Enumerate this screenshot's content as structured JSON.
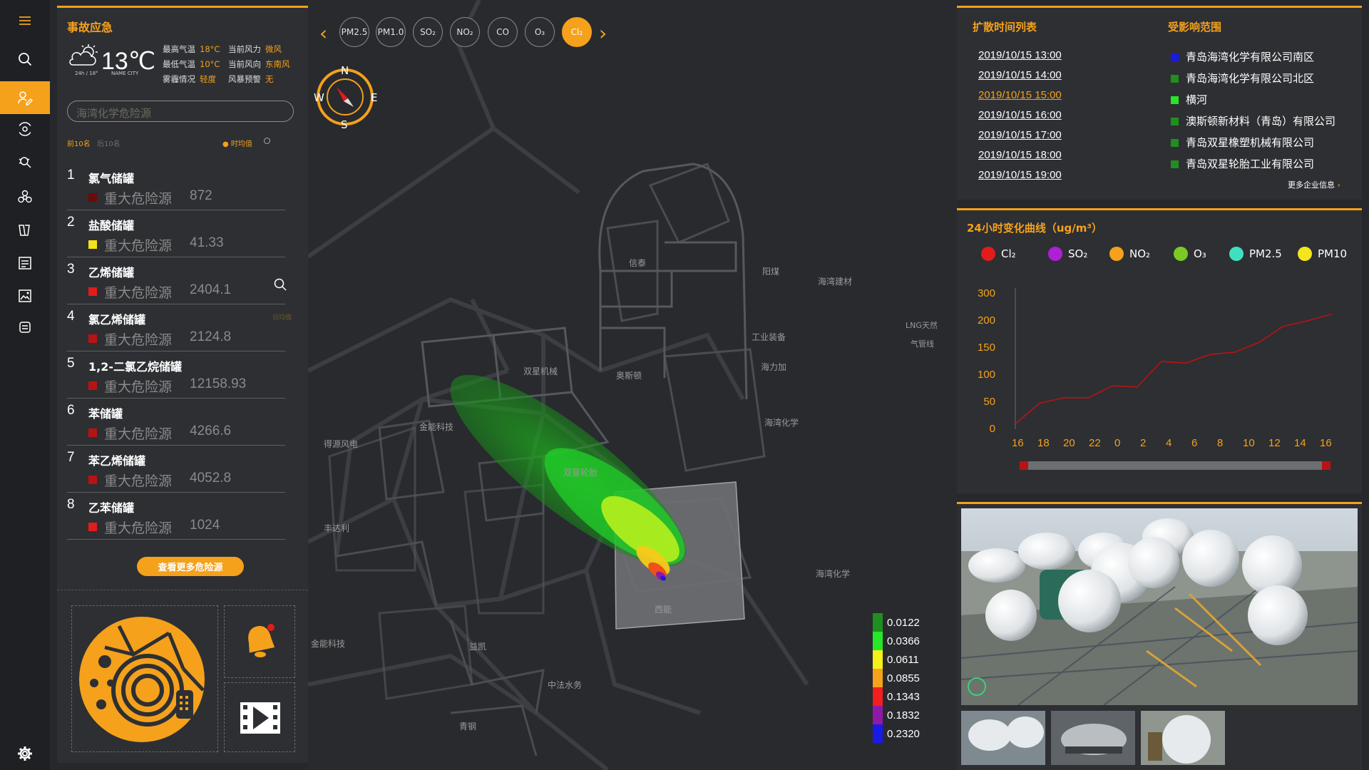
{
  "rail": {
    "items": [
      "menu-icon",
      "search-icon",
      "person-edit-icon",
      "radiation-icon",
      "bug-search-icon",
      "biohazard-icon",
      "book-icon",
      "report-icon",
      "image-report-icon",
      "list-icon",
      "settings-icon"
    ],
    "active_index": 2
  },
  "left_panel": {
    "title": "事故应急",
    "weather": {
      "temp": "13℃",
      "sub_left": "24h / 18°",
      "sub_city": "NAME CITY",
      "rows": [
        {
          "label": "最高气温",
          "value": "18°C",
          "label2": "当前风力",
          "value2": "微风"
        },
        {
          "label": "最低气温",
          "value": "10°C",
          "label2": "当前风向",
          "value2": "东南风"
        },
        {
          "label": "雾霾情况",
          "value": "轻度",
          "label2": "风暴预警",
          "value2": "无"
        }
      ]
    },
    "search_placeholder": "海湾化学危险源",
    "tabs": {
      "first": "前10名",
      "second": "后10名",
      "toggle_left": "时均值",
      "toggle_right": "日均值"
    },
    "category": "重大危险源",
    "items": [
      {
        "rank": "1",
        "name": "氯气储罐",
        "value": "872",
        "color": "#6b0b0b"
      },
      {
        "rank": "2",
        "name": "盐酸储罐",
        "value": "41.33",
        "color": "#f2e21a"
      },
      {
        "rank": "3",
        "name": "乙烯储罐",
        "value": "2404.1",
        "color": "#e21b1b"
      },
      {
        "rank": "4",
        "name": "氯乙烯储罐",
        "value": "2124.8",
        "color": "#b81313"
      },
      {
        "rank": "5",
        "name": "1,2-二氯乙烷储罐",
        "value": "12158.93",
        "color": "#b81313"
      },
      {
        "rank": "6",
        "name": "苯储罐",
        "value": "4266.6",
        "color": "#b81313"
      },
      {
        "rank": "7",
        "name": "苯乙烯储罐",
        "value": "4052.8",
        "color": "#b81313"
      },
      {
        "rank": "8",
        "name": "乙苯储罐",
        "value": "1024",
        "color": "#e21b1b"
      }
    ],
    "more_button": "查看更多危险源"
  },
  "map": {
    "pollutants": [
      "PM2.5",
      "PM1.0",
      "SO₂",
      "NO₂",
      "CO",
      "O₃",
      "Cl₂"
    ],
    "active_pollutant": "Cl₂",
    "compass": {
      "n": "N",
      "s": "S",
      "e": "E",
      "w": "W"
    },
    "labels": [
      "信泰",
      "阳煤",
      "海湾建材",
      "工业装备",
      "海力加",
      "LNG天然",
      "气管线",
      "双星机械",
      "奥斯顿",
      "金能科技",
      "海湾化学",
      "得源风电",
      "双星轮胎",
      "丰达利",
      "海湾化学",
      "西能",
      "金能科技",
      "益凯",
      "中法水务",
      "青钢"
    ],
    "scale": [
      {
        "value": "0.0122",
        "color": "#1f8f1f"
      },
      {
        "value": "0.0366",
        "color": "#27e627"
      },
      {
        "value": "0.0611",
        "color": "#f2f21a"
      },
      {
        "value": "0.0855",
        "color": "#f5a11b"
      },
      {
        "value": "0.1343",
        "color": "#f21f1f"
      },
      {
        "value": "0.1832",
        "color": "#8d1aa6"
      },
      {
        "value": "0.2320",
        "color": "#1a1ae6"
      }
    ]
  },
  "diffusion": {
    "title": "扩散时间列表",
    "times": [
      "2019/10/15 13:00",
      "2019/10/15 14:00",
      "2019/10/15 15:00",
      "2019/10/15 16:00",
      "2019/10/15 17:00",
      "2019/10/15 18:00",
      "2019/10/15 19:00"
    ],
    "active_time": "2019/10/15 15:00"
  },
  "affected": {
    "title": "受影响范围",
    "items": [
      {
        "name": "青岛海湾化学有限公司南区",
        "color": "#1a1ae6"
      },
      {
        "name": "青岛海湾化学有限公司北区",
        "color": "#1f8f1f"
      },
      {
        "name": "横河",
        "color": "#27e627"
      },
      {
        "name": "澳斯顿新材料（青岛）有限公司",
        "color": "#1f8f1f"
      },
      {
        "name": "青岛双星橡塑机械有限公司",
        "color": "#1f8f1f"
      },
      {
        "name": "青岛双星轮胎工业有限公司",
        "color": "#1f8f1f"
      }
    ],
    "more": "更多企业信息"
  },
  "chart_data": {
    "type": "line",
    "title": "24小时变化曲线（ug/m³）",
    "legend": [
      {
        "name": "Cl₂",
        "color": "#e21b1b"
      },
      {
        "name": "SO₂",
        "color": "#b01ed6"
      },
      {
        "name": "NO₂",
        "color": "#f5a11b"
      },
      {
        "name": "O₃",
        "color": "#7ac925"
      },
      {
        "name": "PM2.5",
        "color": "#3fe0c0"
      },
      {
        "name": "PM10",
        "color": "#f5e51b"
      }
    ],
    "x_ticks": [
      "16",
      "18",
      "20",
      "22",
      "0",
      "2",
      "4",
      "6",
      "8",
      "10",
      "12",
      "14",
      "16"
    ],
    "y_ticks": [
      "300",
      "200",
      "150",
      "100",
      "50",
      "0"
    ],
    "series": [
      {
        "name": "Cl₂",
        "color": "#b81313",
        "values": [
          10,
          48,
          58,
          58,
          80,
          78,
          125,
          122,
          138,
          142,
          160,
          190,
          200,
          225
        ]
      }
    ],
    "ylim": [
      0,
      300
    ]
  }
}
